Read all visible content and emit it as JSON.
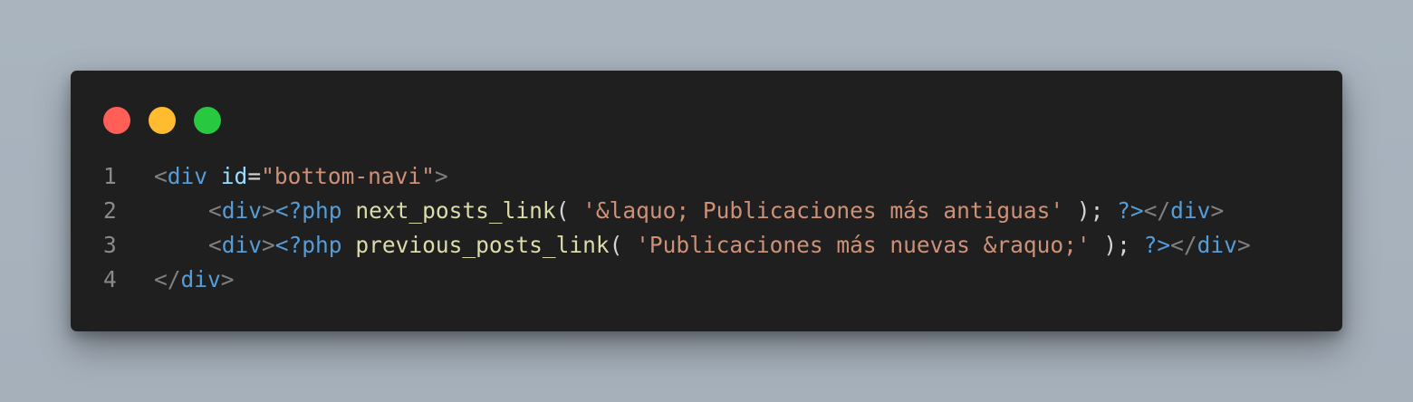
{
  "colors": {
    "red_dot": "#ff5f57",
    "yellow_dot": "#febc2e",
    "green_dot": "#28c840",
    "bracket": "#808080",
    "tag": "#569cd6",
    "attr": "#9cdcfe",
    "string": "#ce9178",
    "function": "#dcdcaa",
    "plain": "#d4d4d4"
  },
  "lines": [
    {
      "number": "1",
      "indent": false,
      "tokens": [
        {
          "t": "<",
          "k": "bracket"
        },
        {
          "t": "div",
          "k": "tag"
        },
        {
          "t": " ",
          "k": "plain"
        },
        {
          "t": "id",
          "k": "attr"
        },
        {
          "t": "=",
          "k": "plain"
        },
        {
          "t": "\"bottom-navi\"",
          "k": "string"
        },
        {
          "t": ">",
          "k": "bracket"
        }
      ]
    },
    {
      "number": "2",
      "indent": true,
      "tokens": [
        {
          "t": "<",
          "k": "bracket"
        },
        {
          "t": "div",
          "k": "tag"
        },
        {
          "t": ">",
          "k": "bracket"
        },
        {
          "t": "<?php",
          "k": "tag"
        },
        {
          "t": " ",
          "k": "plain"
        },
        {
          "t": "next_posts_link",
          "k": "function"
        },
        {
          "t": "( ",
          "k": "plain"
        },
        {
          "t": "'&laquo; Publicaciones más antiguas'",
          "k": "string"
        },
        {
          "t": " ); ",
          "k": "plain"
        },
        {
          "t": "?>",
          "k": "tag"
        },
        {
          "t": "</",
          "k": "bracket"
        },
        {
          "t": "div",
          "k": "tag"
        },
        {
          "t": ">",
          "k": "bracket"
        }
      ]
    },
    {
      "number": "3",
      "indent": true,
      "tokens": [
        {
          "t": "<",
          "k": "bracket"
        },
        {
          "t": "div",
          "k": "tag"
        },
        {
          "t": ">",
          "k": "bracket"
        },
        {
          "t": "<?php",
          "k": "tag"
        },
        {
          "t": " ",
          "k": "plain"
        },
        {
          "t": "previous_posts_link",
          "k": "function"
        },
        {
          "t": "( ",
          "k": "plain"
        },
        {
          "t": "'Publicaciones más nuevas &raquo;'",
          "k": "string"
        },
        {
          "t": " ); ",
          "k": "plain"
        },
        {
          "t": "?>",
          "k": "tag"
        },
        {
          "t": "</",
          "k": "bracket"
        },
        {
          "t": "div",
          "k": "tag"
        },
        {
          "t": ">",
          "k": "bracket"
        }
      ]
    },
    {
      "number": "4",
      "indent": false,
      "tokens": [
        {
          "t": "</",
          "k": "bracket"
        },
        {
          "t": "div",
          "k": "tag"
        },
        {
          "t": ">",
          "k": "bracket"
        }
      ]
    }
  ]
}
